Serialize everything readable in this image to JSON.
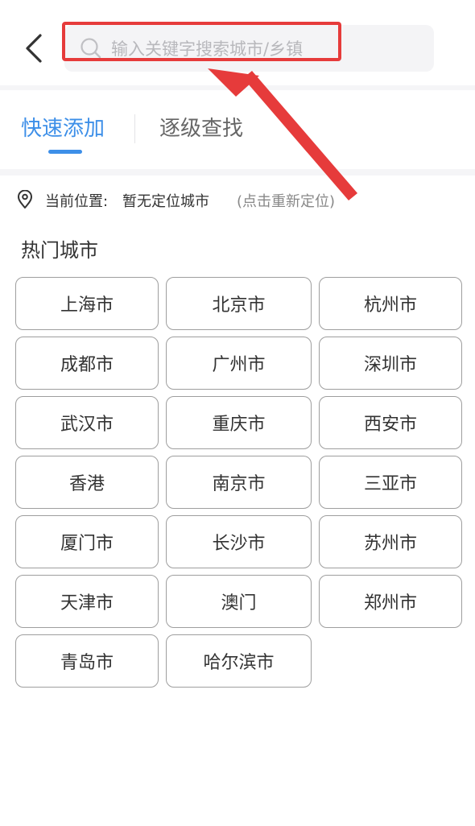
{
  "header": {
    "search_placeholder": "输入关键字搜索城市/乡镇"
  },
  "tabs": [
    {
      "label": "快速添加",
      "active": true
    },
    {
      "label": "逐级查找",
      "active": false
    }
  ],
  "location": {
    "label": "当前位置:",
    "value": "暂无定位城市",
    "relocate": "(点击重新定位)"
  },
  "hot_cities": {
    "title": "热门城市",
    "items": [
      "上海市",
      "北京市",
      "杭州市",
      "成都市",
      "广州市",
      "深圳市",
      "武汉市",
      "重庆市",
      "西安市",
      "香港",
      "南京市",
      "三亚市",
      "厦门市",
      "长沙市",
      "苏州市",
      "天津市",
      "澳门",
      "郑州市",
      "青岛市",
      "哈尔滨市"
    ]
  },
  "colors": {
    "accent": "#3d8fe8",
    "annotation": "#e63b3b"
  },
  "icons": {
    "back": "chevron-left-icon",
    "search": "search-icon",
    "location": "location-pin-icon"
  }
}
